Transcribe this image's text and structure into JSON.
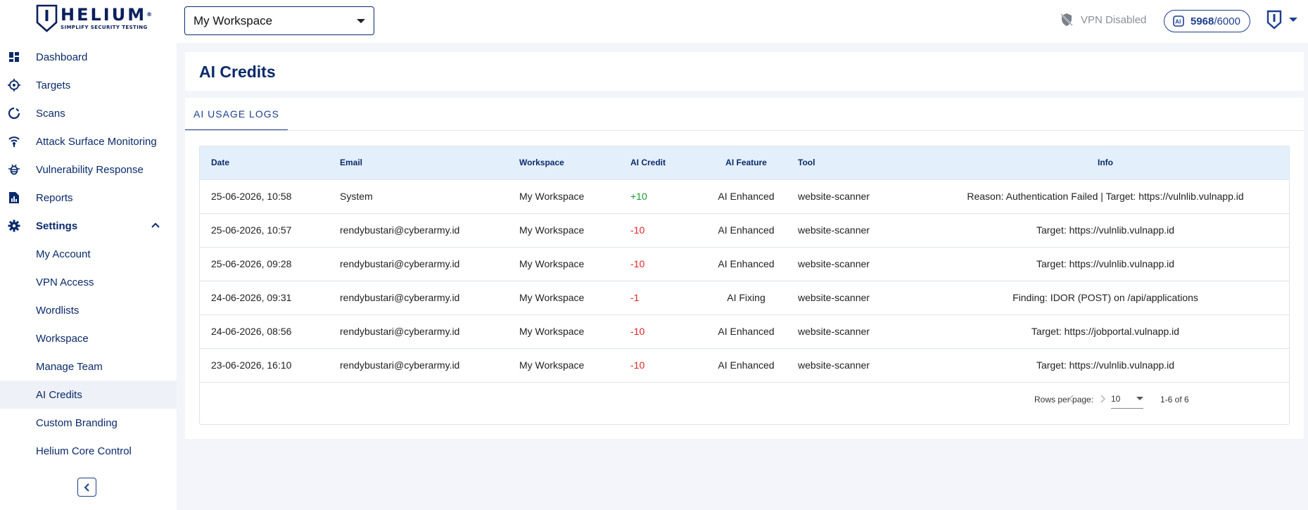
{
  "brand": {
    "name": "HELIUM",
    "tagline": "SIMPLIFY SECURITY TESTING",
    "color": "#0a1f5c"
  },
  "header": {
    "workspace_select": {
      "value": "My Workspace"
    },
    "vpn_status": "VPN Disabled",
    "credits": {
      "used": "5968",
      "separator": "/",
      "total": "6000"
    }
  },
  "sidebar": {
    "items": [
      {
        "label": "Dashboard",
        "icon": "dashboard-icon"
      },
      {
        "label": "Targets",
        "icon": "target-icon"
      },
      {
        "label": "Scans",
        "icon": "scan-icon"
      },
      {
        "label": "Attack Surface Monitoring",
        "icon": "broadcast-icon"
      },
      {
        "label": "Vulnerability Response",
        "icon": "bug-icon"
      },
      {
        "label": "Reports",
        "icon": "report-icon"
      },
      {
        "label": "Settings",
        "icon": "gear-icon",
        "expanded": true
      },
      {
        "label": "My Account"
      },
      {
        "label": "VPN Access"
      },
      {
        "label": "Wordlists"
      },
      {
        "label": "Workspace"
      },
      {
        "label": "Manage Team"
      },
      {
        "label": "AI Credits",
        "active": true
      },
      {
        "label": "Custom Branding"
      },
      {
        "label": "Helium Core Control"
      }
    ]
  },
  "main": {
    "title": "AI Credits",
    "tabs": [
      {
        "label": "AI USAGE LOGS",
        "active": true
      }
    ],
    "table": {
      "headers": {
        "date": "Date",
        "email": "Email",
        "workspace": "Workspace",
        "credit": "AI Credit",
        "feature": "AI Feature",
        "tool": "Tool",
        "info": "Info"
      },
      "rows": [
        {
          "date": "25-06-2026, 10:58",
          "email": "System",
          "workspace": "My Workspace",
          "credit": "+10",
          "feature": "AI Enhanced",
          "tool": "website-scanner",
          "info": "Reason: Authentication Failed | Target: https://vulnlib.vulnapp.id"
        },
        {
          "date": "25-06-2026, 10:57",
          "email": "rendybustari@cyberarmy.id",
          "workspace": "My Workspace",
          "credit": "-10",
          "feature": "AI Enhanced",
          "tool": "website-scanner",
          "info": "Target: https://vulnlib.vulnapp.id"
        },
        {
          "date": "25-06-2026, 09:28",
          "email": "rendybustari@cyberarmy.id",
          "workspace": "My Workspace",
          "credit": "-10",
          "feature": "AI Enhanced",
          "tool": "website-scanner",
          "info": "Target: https://vulnlib.vulnapp.id"
        },
        {
          "date": "24-06-2026, 09:31",
          "email": "rendybustari@cyberarmy.id",
          "workspace": "My Workspace",
          "credit": "-1",
          "feature": "AI Fixing",
          "tool": "website-scanner",
          "info": "Finding: IDOR (POST) on /api/applications"
        },
        {
          "date": "24-06-2026, 08:56",
          "email": "rendybustari@cyberarmy.id",
          "workspace": "My Workspace",
          "credit": "-10",
          "feature": "AI Enhanced",
          "tool": "website-scanner",
          "info": "Target: https://jobportal.vulnapp.id"
        },
        {
          "date": "23-06-2026, 16:10",
          "email": "rendybustari@cyberarmy.id",
          "workspace": "My Workspace",
          "credit": "-10",
          "feature": "AI Enhanced",
          "tool": "website-scanner",
          "info": "Target: https://vulnlib.vulnapp.id"
        }
      ]
    },
    "pagination": {
      "rows_per_page_label": "Rows per page:",
      "rows_per_page": "10",
      "range": "1-6 of 6"
    }
  },
  "colors": {
    "accent": "#1d3f8f",
    "nav_text": "#0a2a6b",
    "positive": "#1e9a2e",
    "negative": "#e02424",
    "table_header_bg": "#e3effb"
  }
}
